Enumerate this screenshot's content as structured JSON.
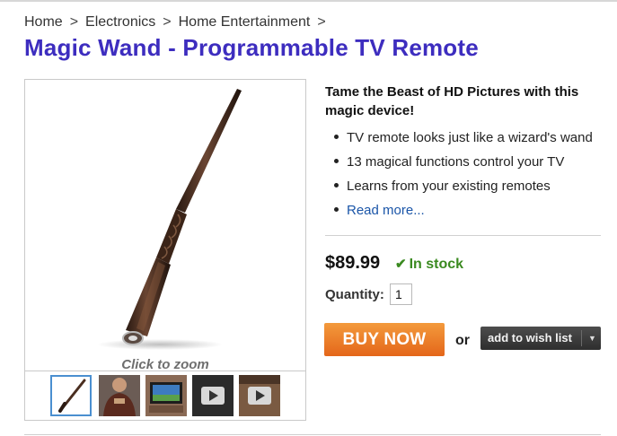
{
  "breadcrumb": {
    "items": [
      "Home",
      "Electronics",
      "Home Entertainment"
    ],
    "separator": ">"
  },
  "product": {
    "title": "Magic Wand - Programmable TV Remote",
    "tagline": "Tame the Beast of HD Pictures with this magic device!",
    "features": [
      "TV remote looks just like a wizard's wand",
      "13 magical functions control your TV",
      "Learns from your existing remotes"
    ],
    "read_more": "Read more...",
    "price": "$89.99",
    "stock_status": "In stock",
    "stock_icon": "checkmark-icon",
    "quantity_label": "Quantity:",
    "quantity_value": "1"
  },
  "gallery": {
    "zoom_label": "Click to zoom",
    "thumbnails": [
      {
        "kind": "image",
        "subject": "wand",
        "selected": true
      },
      {
        "kind": "image",
        "subject": "person-shirt",
        "selected": false
      },
      {
        "kind": "image",
        "subject": "tv-screen",
        "selected": false
      },
      {
        "kind": "video",
        "subject": "video-play",
        "selected": false
      },
      {
        "kind": "video",
        "subject": "video-play",
        "selected": false
      }
    ]
  },
  "actions": {
    "buy_label": "BUY NOW",
    "or_label": "or",
    "wishlist_label": "add to wish list",
    "wishlist_icon": "dropdown-caret-icon"
  },
  "colors": {
    "title": "#3d2dbf",
    "link": "#1a55a8",
    "in_stock": "#3a8a20",
    "buy_button": "#e97a26",
    "wishlist_button": "#3a3a3a",
    "thumb_selected_border": "#4a8fd0"
  }
}
